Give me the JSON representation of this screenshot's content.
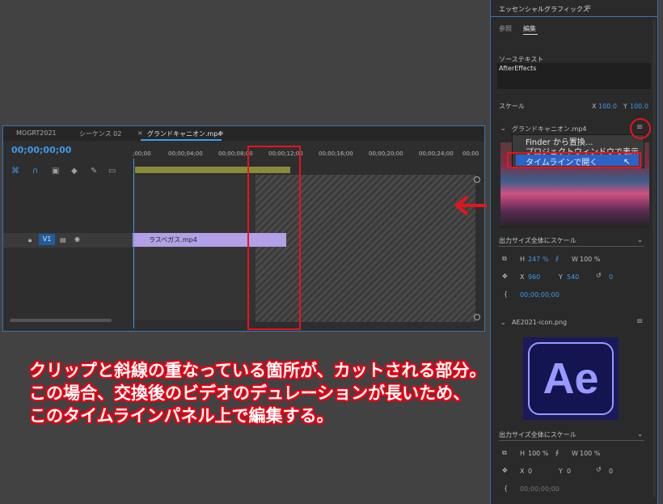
{
  "timeline": {
    "tabs": [
      "MOGRT2021",
      "シーケンス 02",
      "グランドキャニオン.mp4"
    ],
    "tab_close": "×",
    "tab_menu": "≡",
    "timecode": "00;00;00;00",
    "ruler": [
      ";00;00",
      "00;00;04;00",
      "00;00;08;00",
      "00;00;12;00",
      "00;00;16;00",
      "00;00;20;00",
      "00;00;24;00",
      "00;00"
    ],
    "track_label": "V1",
    "clip_name": "ラスベガス.mp4"
  },
  "essential": {
    "title": "エッセンシャルグラフィックス",
    "tabs": [
      "参照",
      "編集"
    ],
    "source_text_label": "ソーステキスト",
    "source_text_value": "AfterEffects",
    "scale_label": "スケール",
    "scale_x_label": "X",
    "scale_x": "100.0",
    "scale_y_label": "Y",
    "scale_y": "100.0",
    "layer1": {
      "name": "グランドキャニオン.mp4",
      "menu": [
        "Finder から置換...",
        "プロジェクトウィンドウで表示",
        "タイムラインで開く"
      ],
      "fit": "出力サイズ全体にスケール",
      "h_label": "H",
      "h": "247 %",
      "w_label": "W",
      "w": "100 %",
      "x_label": "X",
      "x": "960",
      "y_label": "Y",
      "y": "540",
      "rot": "0",
      "time": "00;00;00;00"
    },
    "layer2": {
      "name": "AE2021-icon.png",
      "logo_text": "Ae",
      "fit": "出力サイズ全体にスケール",
      "h_label": "H",
      "h": "100 %",
      "w_label": "W",
      "w": "100 %",
      "x_label": "X",
      "x": "0",
      "y_label": "Y",
      "y": "0",
      "rot": "0",
      "time": "00;00;00;00"
    }
  },
  "caption": [
    "クリップと斜線の重なっている箇所が、カットされる部分。",
    "この場合、交換後のビデオのデュレーションが長いため、",
    "このタイムラインパネル上で編集する。"
  ],
  "colors": {
    "accent_blue": "#3d9be9",
    "annotation_red": "#e8131d",
    "clip_purple": "#b3a0e6"
  }
}
